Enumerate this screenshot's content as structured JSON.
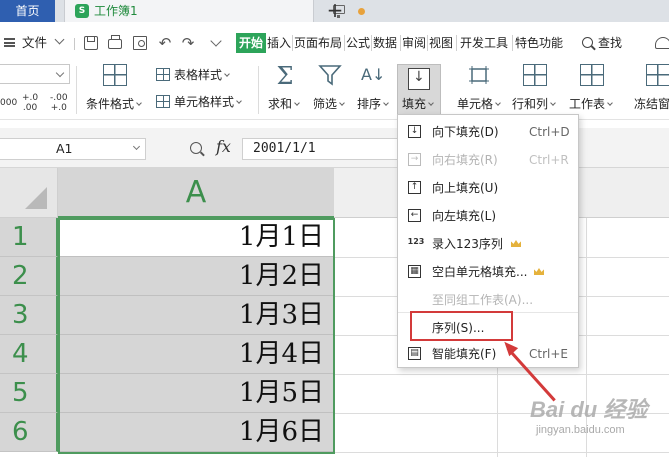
{
  "tabs": {
    "home_label": "首页",
    "file_label": "工作簿1",
    "et_logo_text": "S",
    "add_label": "+"
  },
  "menubar": {
    "file_label": "文件",
    "items": [
      "开始",
      "插入",
      "页面布局",
      "公式",
      "数据",
      "审阅",
      "视图",
      "开发工具",
      "特色功能"
    ],
    "active_index": 0,
    "search_label": "查找",
    "undo_glyph": "↶",
    "redo_glyph": "↷"
  },
  "ribbon": {
    "num_buttons": [
      "000",
      "+.0\n.00",
      "-.00\n+.0"
    ],
    "conditional_format": "条件格式",
    "table_style": "表格样式",
    "cell_style": "单元格样式",
    "sum": "求和",
    "filter": "筛选",
    "sort": "排序",
    "fill": "填充",
    "cell": "单元格",
    "row_col": "行和列",
    "worksheet": "工作表",
    "freeze": "冻结窗",
    "sum_glyph": "Σ",
    "sort_glyph": "A↓"
  },
  "formula_bar": {
    "cell_ref": "A1",
    "fx_label": "fx",
    "value": "2001/1/1"
  },
  "sheet": {
    "column_header": "A",
    "rows": [
      {
        "num": "1",
        "value": "1月1日"
      },
      {
        "num": "2",
        "value": "1月2日"
      },
      {
        "num": "3",
        "value": "1月3日"
      },
      {
        "num": "4",
        "value": "1月4日"
      },
      {
        "num": "5",
        "value": "1月5日"
      },
      {
        "num": "6",
        "value": "1月6日"
      }
    ]
  },
  "fill_menu": {
    "items": [
      {
        "label": "向下填充(D)",
        "shortcut": "Ctrl+D",
        "enabled": true,
        "icon": "fill-down-icon",
        "glyph": "↓"
      },
      {
        "label": "向右填充(R)",
        "shortcut": "Ctrl+R",
        "enabled": false,
        "icon": "fill-right-icon",
        "glyph": "→"
      },
      {
        "label": "向上填充(U)",
        "shortcut": "",
        "enabled": true,
        "icon": "fill-up-icon",
        "glyph": "↑"
      },
      {
        "label": "向左填充(L)",
        "shortcut": "",
        "enabled": true,
        "icon": "fill-left-icon",
        "glyph": "←"
      },
      {
        "label": "录入123序列",
        "shortcut": "",
        "enabled": true,
        "icon": "sequence-123-icon",
        "glyph": "123"
      },
      {
        "label": "空白单元格填充...",
        "shortcut": "",
        "enabled": true,
        "icon": "blank-cell-fill-icon",
        "glyph": "▦"
      },
      {
        "label": "至同组工作表(A)...",
        "shortcut": "",
        "enabled": false,
        "icon": "",
        "glyph": ""
      },
      {
        "label": "序列(S)...",
        "shortcut": "",
        "enabled": true,
        "icon": "",
        "glyph": ""
      },
      {
        "label": "智能填充(F)",
        "shortcut": "Ctrl+E",
        "enabled": true,
        "icon": "smart-fill-icon",
        "glyph": "▤"
      }
    ]
  },
  "watermark": {
    "logo": "Bai du 经验",
    "sub": "jingyan.baidu.com"
  },
  "colors": {
    "accent_green": "#2da45a",
    "home_tab_blue": "#2f5fb0",
    "selection_green": "#4f9b5f",
    "annotation_red": "#d33a3a",
    "crown_gold": "#e5b23c"
  }
}
